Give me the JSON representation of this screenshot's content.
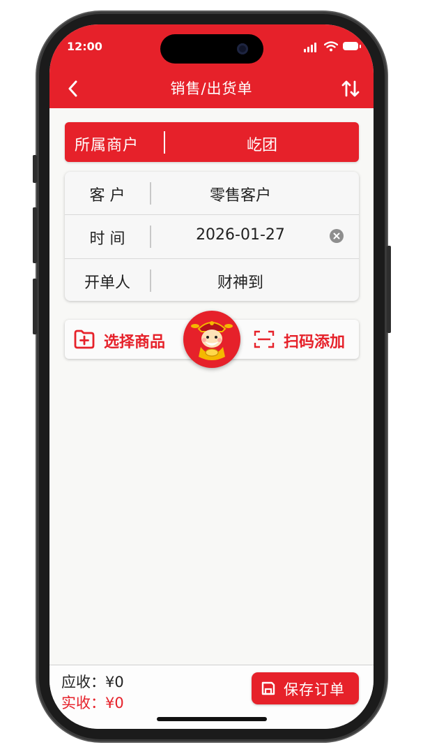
{
  "status_bar": {
    "time": "12:00"
  },
  "nav": {
    "title": "销售/出货单",
    "back_icon": "chevron-left-icon",
    "sort_icon": "swap-vertical-icon"
  },
  "merchant": {
    "label": "所属商户",
    "value": "屹团"
  },
  "form": {
    "customer": {
      "label": "客 户",
      "value": "零售客户"
    },
    "time": {
      "label": "时 间",
      "value": "2026-01-27"
    },
    "operator": {
      "label": "开单人",
      "value": "财神到"
    }
  },
  "actions": {
    "select_goods": "选择商品",
    "scan_add": "扫码添加",
    "select_icon": "folder-plus-icon",
    "scan_icon": "scan-frame-icon",
    "mascot_icon": "god-of-wealth-mascot"
  },
  "footer": {
    "due": "应收：¥0",
    "paid": "实收：¥0",
    "save_label": "保存订单",
    "save_icon": "save-disk-icon"
  },
  "colors": {
    "brand": "#e6212a",
    "background": "#f8f8f6"
  }
}
